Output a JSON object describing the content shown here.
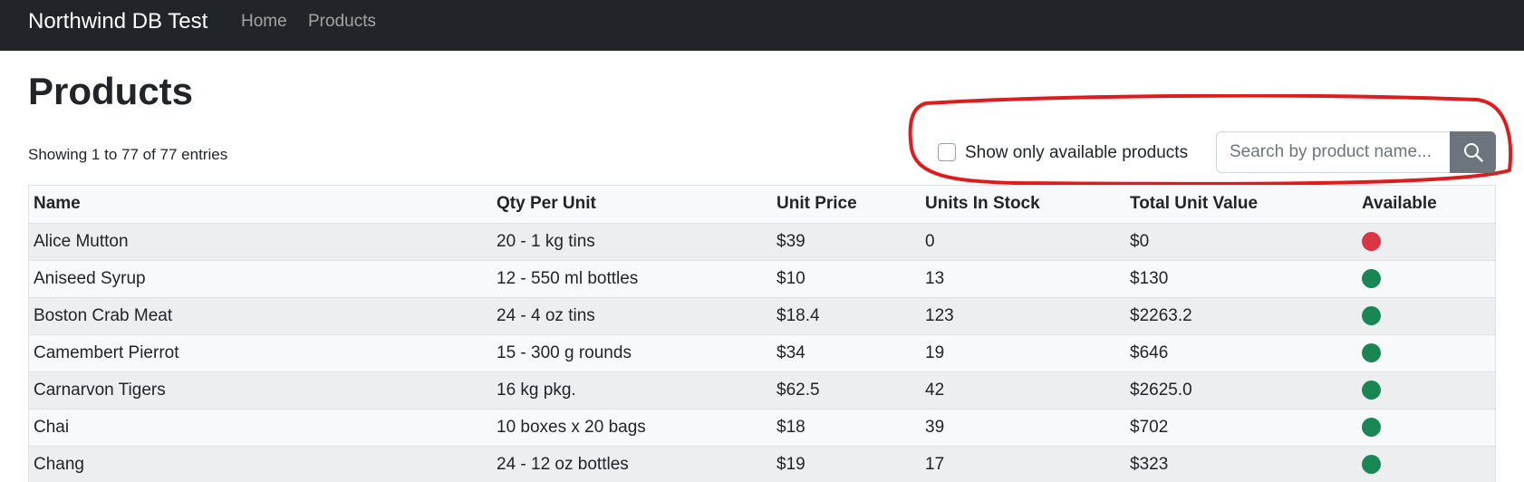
{
  "navbar": {
    "brand": "Northwind DB Test",
    "links": [
      {
        "label": "Home"
      },
      {
        "label": "Products"
      }
    ]
  },
  "page": {
    "title": "Products",
    "entries_info": "Showing 1 to 77 of 77 entries"
  },
  "filters": {
    "available_only_label": "Show only available products",
    "available_only_checked": false,
    "search_placeholder": "Search by product name...",
    "search_value": "",
    "search_icon": "search-icon"
  },
  "colors": {
    "navbar_bg": "#212529",
    "search_button_bg": "#6c757d",
    "available": "#198754",
    "unavailable": "#dc3545",
    "annotation": "#e01b1b"
  },
  "table": {
    "columns": [
      "Name",
      "Qty Per Unit",
      "Unit Price",
      "Units In Stock",
      "Total Unit Value",
      "Available"
    ],
    "rows": [
      {
        "name": "Alice Mutton",
        "qty": "20 - 1 kg tins",
        "price": "$39",
        "stock": "0",
        "total": "$0",
        "available": false
      },
      {
        "name": "Aniseed Syrup",
        "qty": "12 - 550 ml bottles",
        "price": "$10",
        "stock": "13",
        "total": "$130",
        "available": true
      },
      {
        "name": "Boston Crab Meat",
        "qty": "24 - 4 oz tins",
        "price": "$18.4",
        "stock": "123",
        "total": "$2263.2",
        "available": true
      },
      {
        "name": "Camembert Pierrot",
        "qty": "15 - 300 g rounds",
        "price": "$34",
        "stock": "19",
        "total": "$646",
        "available": true
      },
      {
        "name": "Carnarvon Tigers",
        "qty": "16 kg pkg.",
        "price": "$62.5",
        "stock": "42",
        "total": "$2625.0",
        "available": true
      },
      {
        "name": "Chai",
        "qty": "10 boxes x 20 bags",
        "price": "$18",
        "stock": "39",
        "total": "$702",
        "available": true
      },
      {
        "name": "Chang",
        "qty": "24 - 12 oz bottles",
        "price": "$19",
        "stock": "17",
        "total": "$323",
        "available": true
      }
    ]
  }
}
